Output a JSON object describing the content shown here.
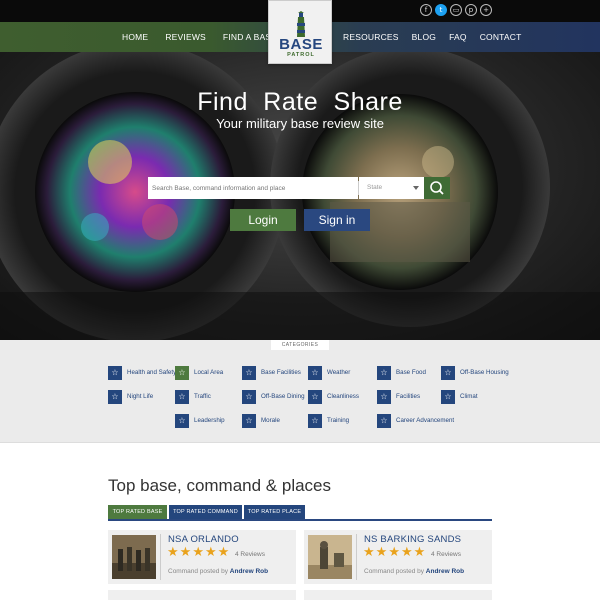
{
  "nav": {
    "left": [
      "HOME",
      "REVIEWS",
      "FIND A BASE"
    ],
    "right": [
      "RESOURCES",
      "BLOG",
      "FAQ",
      "CONTACT"
    ]
  },
  "logo": {
    "word": "BASE",
    "sub": "PATROL"
  },
  "socials": [
    "f",
    "t",
    "▭",
    "p",
    "+"
  ],
  "hero": {
    "title": "Find  Rate  Share",
    "subtitle": "Your military base review site",
    "search_placeholder": "Search Base, command information and place",
    "state_label": "State",
    "login": "Login",
    "signin": "Sign in"
  },
  "categories": {
    "tab": "CATEGORIES",
    "items": [
      "Health and Safety",
      "Local Area",
      "Base Facilities",
      "Weather",
      "Base Food",
      "Off-Base Housing",
      "Night Life",
      "Traffic",
      "Off-Base Dining",
      "Cleanliness",
      "Facilities",
      "Climat",
      "Leadership",
      "Morale",
      "Training",
      "Career Advancement"
    ]
  },
  "top": {
    "title": "Top base, command & places",
    "tabs": [
      "TOP RATED BASE",
      "TOP RATED COMMAND",
      "TOP RATED PLACE"
    ],
    "cards": [
      {
        "name": "NSA ORLANDO",
        "reviews": "4 Reviews",
        "posted_prefix": "Command posted by",
        "author": "Andrew Rob",
        "rating": 5
      },
      {
        "name": "NS BARKING SANDS",
        "reviews": "4 Reviews",
        "posted_prefix": "Command posted by",
        "author": "Andrew Rob",
        "rating": 5
      }
    ]
  },
  "colors": {
    "navy": "#24467d",
    "green": "#4e7a3f",
    "star": "#e9a21c"
  }
}
